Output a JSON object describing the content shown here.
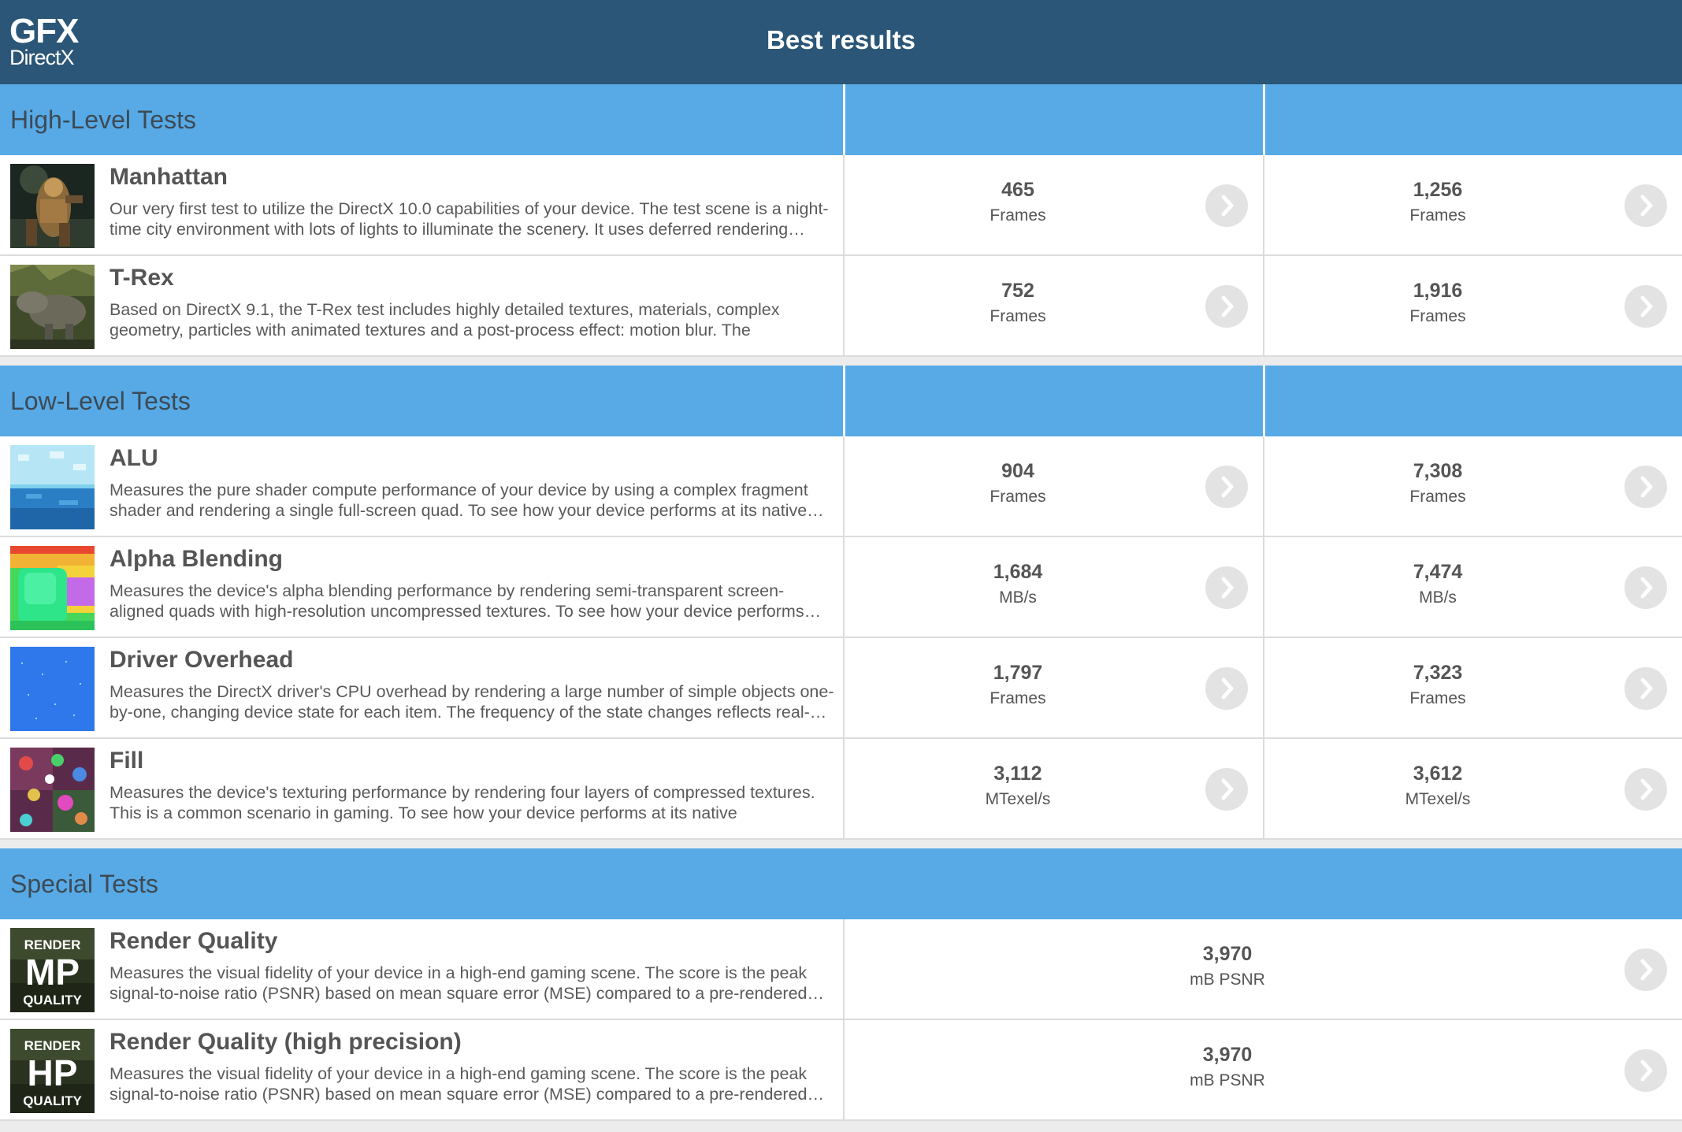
{
  "header": {
    "logo_line1": "GFX",
    "logo_line2": "DirectX",
    "title": "Best results"
  },
  "sections": [
    {
      "label": "High-Level Tests",
      "tests": [
        {
          "name": "Manhattan",
          "icon": "manhattan-thumbnail",
          "description": "Our very first test to utilize the DirectX 10.0 capabilities of your device. The test scene is a night-time city environment with lots of lights to illuminate the scenery. It uses deferred rendering…",
          "score1": "465",
          "unit1": "Frames",
          "score2": "1,256",
          "unit2": "Frames"
        },
        {
          "name": "T-Rex",
          "icon": "trex-thumbnail",
          "description": "Based on DirectX 9.1, the T-Rex test includes highly detailed textures, materials, complex geometry, particles with animated textures and a post-process effect: motion blur. The graphics…",
          "score1": "752",
          "unit1": "Frames",
          "score2": "1,916",
          "unit2": "Frames"
        }
      ]
    },
    {
      "label": "Low-Level Tests",
      "tests": [
        {
          "name": "ALU",
          "icon": "alu-thumbnail",
          "description": "Measures the pure shader compute performance of your device by using a complex fragment shader and rendering a single full-screen quad. To see how your device performs at its native…",
          "score1": "904",
          "unit1": "Frames",
          "score2": "7,308",
          "unit2": "Frames"
        },
        {
          "name": "Alpha Blending",
          "icon": "alpha-blending-thumbnail",
          "description": "Measures the device's alpha blending performance by rendering semi-transparent screen-aligned quads with high-resolution uncompressed textures. To see how your device performs…",
          "score1": "1,684",
          "unit1": "MB/s",
          "score2": "7,474",
          "unit2": "MB/s"
        },
        {
          "name": "Driver Overhead",
          "icon": "driver-overhead-thumbnail",
          "description": "Measures the DirectX driver's CPU overhead by rendering a large number of simple objects one-by-one, changing device state for each item. The frequency of the state changes reflects real-…",
          "score1": "1,797",
          "unit1": "Frames",
          "score2": "7,323",
          "unit2": "Frames"
        },
        {
          "name": "Fill",
          "icon": "fill-thumbnail",
          "description": "Measures the device's texturing performance by rendering four layers of compressed textures. This is a common scenario in gaming. To see how your device performs at its native resolution,…",
          "score1": "3,112",
          "unit1": "MTexel/s",
          "score2": "3,612",
          "unit2": "MTexel/s"
        }
      ]
    },
    {
      "label": "Special Tests",
      "tests": [
        {
          "name": "Render Quality",
          "icon": "render-quality-mp-thumbnail",
          "badge_top": "RENDER",
          "badge_mid": "MP",
          "badge_bottom": "QUALITY",
          "description": "Measures the visual fidelity of your device in a high-end gaming scene. The score is the peak signal-to-noise ratio (PSNR) based on mean square error (MSE) compared to a pre-rendered…",
          "score": "3,970",
          "unit": "mB PSNR"
        },
        {
          "name": "Render Quality (high precision)",
          "icon": "render-quality-hp-thumbnail",
          "badge_top": "RENDER",
          "badge_mid": "HP",
          "badge_bottom": "QUALITY",
          "description": "Measures the visual fidelity of your device in a high-end gaming scene. The score is the peak signal-to-noise ratio (PSNR) based on mean square error (MSE) compared to a pre-rendered…",
          "score": "3,970",
          "unit": "mB PSNR"
        }
      ]
    }
  ],
  "colors": {
    "header_bg": "#2b5677",
    "section_bg": "#57aae6",
    "row_bg": "#ffffff",
    "chevron_bg": "#e3e3e3"
  }
}
